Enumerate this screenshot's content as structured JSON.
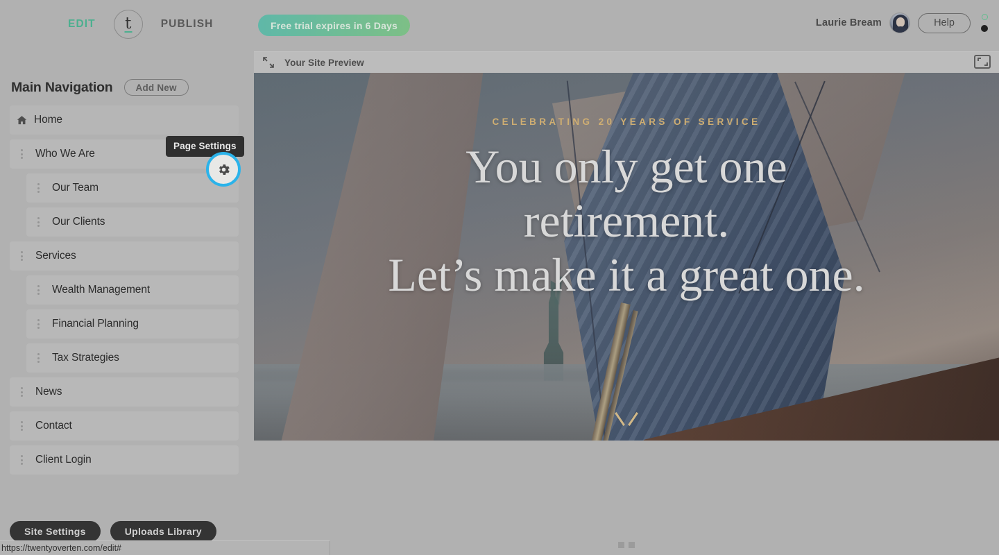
{
  "topbar": {
    "edit_label": "EDIT",
    "publish_label": "PUBLISH",
    "logo_letter": "t",
    "trial_notice": "Free trial expires in 6 Days",
    "user_name": "Laurie Bream",
    "help_label": "Help"
  },
  "sidebar": {
    "title": "Main Navigation",
    "add_new_label": "Add New",
    "tooltip": "Page Settings",
    "items": [
      {
        "label": "Home",
        "level": 0,
        "icon": "home-icon"
      },
      {
        "label": "Who We Are",
        "level": 0,
        "icon": "drag-handle-icon"
      },
      {
        "label": "Our Team",
        "level": 1,
        "icon": "drag-handle-icon"
      },
      {
        "label": "Our Clients",
        "level": 1,
        "icon": "drag-handle-icon"
      },
      {
        "label": "Services",
        "level": 0,
        "icon": "drag-handle-icon"
      },
      {
        "label": "Wealth Management",
        "level": 1,
        "icon": "drag-handle-icon"
      },
      {
        "label": "Financial Planning",
        "level": 1,
        "icon": "drag-handle-icon"
      },
      {
        "label": "Tax Strategies",
        "level": 1,
        "icon": "drag-handle-icon"
      },
      {
        "label": "News",
        "level": 0,
        "icon": "drag-handle-icon"
      },
      {
        "label": "Contact",
        "level": 0,
        "icon": "drag-handle-icon"
      },
      {
        "label": "Client Login",
        "level": 0,
        "icon": "drag-handle-icon"
      }
    ],
    "site_settings_label": "Site Settings",
    "uploads_library_label": "Uploads Library"
  },
  "preview": {
    "bar_title": "Your Site Preview",
    "hero": {
      "eyebrow": "CELEBRATING 20 YEARS OF SERVICE",
      "headline_line1": "You only get one",
      "headline_line2": "retirement.",
      "headline_line3": "Let’s make it a great one."
    }
  },
  "statusbar": {
    "url": "https://twentyoverten.com/edit#"
  },
  "colors": {
    "accent_green": "#4caf8f",
    "highlight_blue": "#2bb3ea",
    "tooltip_bg": "#2f2f2f",
    "dark_pill": "#343434",
    "hero_eyebrow_gold": "#cfae72",
    "app_bg": "#b1b1b1"
  }
}
